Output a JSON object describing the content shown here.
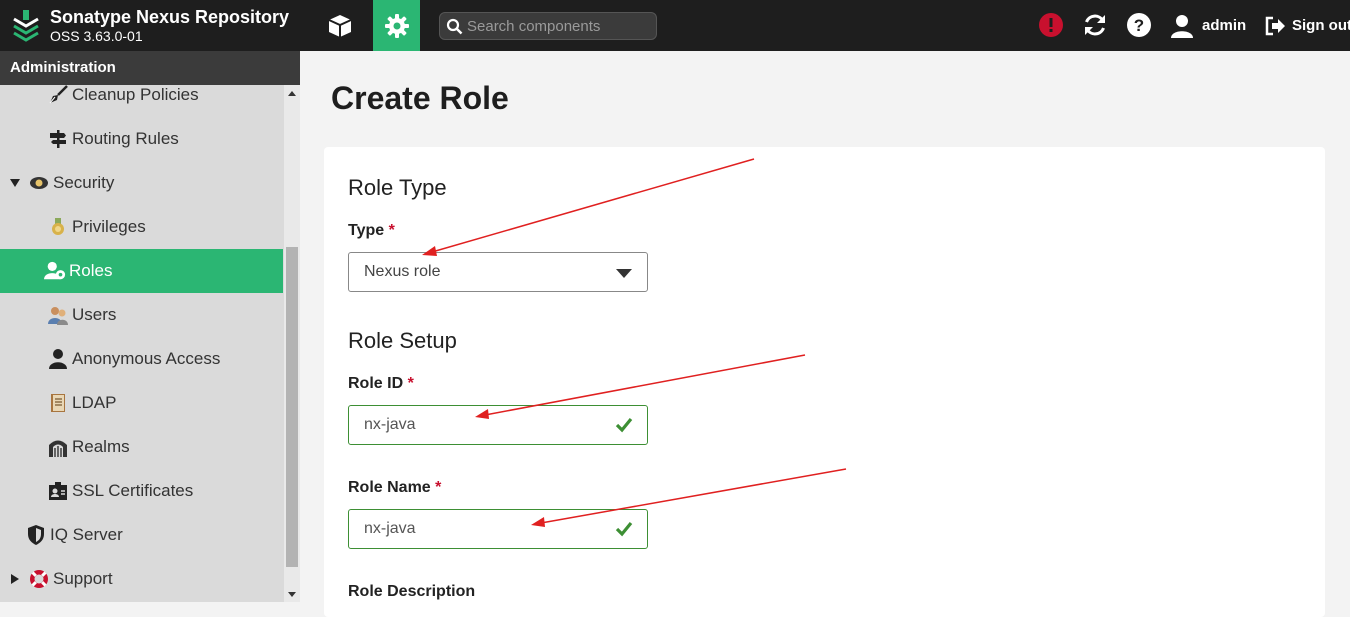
{
  "brand": {
    "title": "Sonatype Nexus Repository",
    "version": "OSS 3.63.0-01"
  },
  "search": {
    "placeholder": "Search components"
  },
  "user": {
    "name": "admin"
  },
  "signout": {
    "label": "Sign out"
  },
  "sidebar": {
    "header": "Administration",
    "items": [
      {
        "label": "Cleanup Policies",
        "icon": "broom-icon"
      },
      {
        "label": "Routing Rules",
        "icon": "signpost-icon"
      },
      {
        "label": "Security",
        "icon": "badge-icon",
        "expanded": true
      },
      {
        "label": "Privileges",
        "icon": "medal-icon"
      },
      {
        "label": "Roles",
        "icon": "roles-icon",
        "active": true
      },
      {
        "label": "Users",
        "icon": "users-icon"
      },
      {
        "label": "Anonymous Access",
        "icon": "person-icon"
      },
      {
        "label": "LDAP",
        "icon": "ldap-book-icon"
      },
      {
        "label": "Realms",
        "icon": "realm-gate-icon"
      },
      {
        "label": "SSL Certificates",
        "icon": "certificate-icon"
      },
      {
        "label": "IQ Server",
        "icon": "shield-icon"
      },
      {
        "label": "Support",
        "icon": "lifebuoy-icon",
        "expanded": false
      }
    ]
  },
  "main": {
    "title": "Create Role",
    "role_type": {
      "heading": "Role Type",
      "type_label": "Type",
      "required_mark": "*",
      "type_value": "Nexus role"
    },
    "role_setup": {
      "heading": "Role Setup",
      "id_label": "Role ID",
      "id_value": "nx-java",
      "name_label": "Role Name",
      "name_value": "nx-java",
      "description_label": "Role Description"
    }
  },
  "colors": {
    "accent": "#2bb673",
    "topbar": "#1e1e1e",
    "alert": "#c8102e",
    "valid": "#3d8f34",
    "annotation_arrow": "#e02020"
  }
}
